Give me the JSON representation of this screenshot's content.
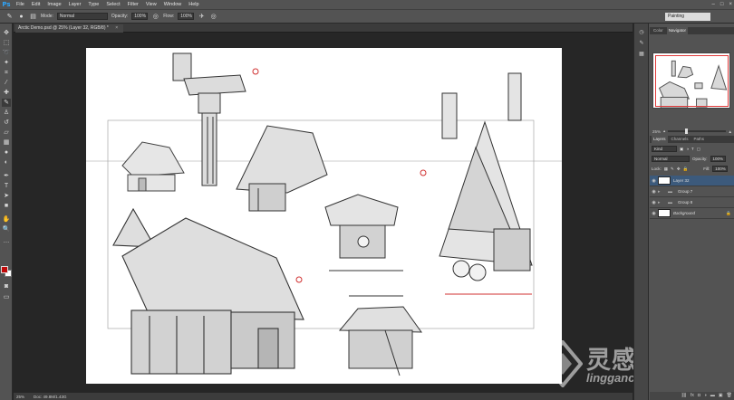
{
  "app": {
    "logo": "Ps"
  },
  "menu": [
    "File",
    "Edit",
    "Image",
    "Layer",
    "Type",
    "Select",
    "Filter",
    "View",
    "Window",
    "Help"
  ],
  "window_controls": [
    "–",
    "□",
    "×"
  ],
  "options": {
    "mode_label": "Mode:",
    "mode_value": "Normal",
    "opacity_label": "Opacity:",
    "opacity_value": "100%",
    "flow_label": "Flow:",
    "flow_value": "100%",
    "workspace": "Painting"
  },
  "document": {
    "tab_title": "Arctic Demo.psd @ 25% (Layer 32, RGB/8) *",
    "close": "×"
  },
  "status": {
    "zoom": "25%",
    "doc": "Doc: 49.8M/1.43G"
  },
  "tools": [
    "move-icon",
    "marquee-icon",
    "lasso-icon",
    "quick-select-icon",
    "crop-icon",
    "eyedropper-icon",
    "healing-icon",
    "brush-icon",
    "stamp-icon",
    "history-brush-icon",
    "eraser-icon",
    "gradient-icon",
    "blur-icon",
    "dodge-icon",
    "pen-icon",
    "type-icon",
    "path-select-icon",
    "shape-icon",
    "hand-icon",
    "zoom-icon"
  ],
  "colors": {
    "foreground": "#c00a0a",
    "background": "#ffffff",
    "accent": "#3c5a7c"
  },
  "navigator": {
    "tabs": [
      "Color",
      "Navigator"
    ],
    "zoom": "25%"
  },
  "layers": {
    "tabs": [
      "Layers",
      "Channels",
      "Paths"
    ],
    "kind_label": "Kind",
    "blend_mode": "Normal",
    "opacity_label": "Opacity:",
    "opacity_value": "100%",
    "lock_label": "Lock:",
    "fill_label": "Fill:",
    "fill_value": "100%",
    "items": [
      {
        "name": "Layer 32",
        "type": "layer",
        "selected": true
      },
      {
        "name": "Group 7",
        "type": "group",
        "selected": false
      },
      {
        "name": "Group 8",
        "type": "group",
        "selected": false
      },
      {
        "name": "Background",
        "type": "background",
        "selected": false
      }
    ]
  },
  "watermark": {
    "title": "灵感中国",
    "subtitle": "lingganchina.com"
  }
}
